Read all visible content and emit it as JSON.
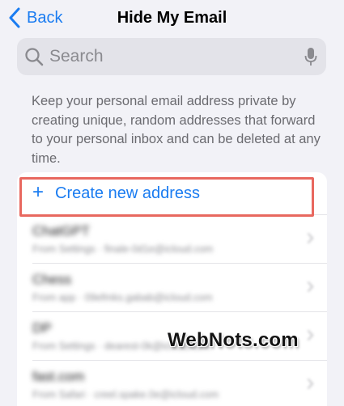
{
  "nav": {
    "back_label": "Back",
    "title": "Hide My Email"
  },
  "search": {
    "placeholder": "Search"
  },
  "description": "Keep your personal email address private by creating unique, random addresses that forward to your personal inbox and can be deleted at any time.",
  "list": {
    "create_plus": "+",
    "create_label": "Create new address",
    "addresses": [
      {
        "name": "ChatGPT",
        "subtitle": "From Settings · finale-0d1e@icloud.com"
      },
      {
        "name": "Chess",
        "subtitle": "From app · 09efmks.gabab@icloud.com"
      },
      {
        "name": "DP",
        "subtitle": "From Settings · dearest-0k@icloud.com"
      },
      {
        "name": "fast.com",
        "subtitle": "From Safari · creel.spake.0e@icloud.com"
      }
    ]
  },
  "watermark": "WebNots.com",
  "colors": {
    "accent": "#1a7cf1",
    "highlight_border": "#e8685f",
    "background": "#f2f2f7"
  },
  "icons": [
    "chevron-left-icon",
    "search-icon",
    "microphone-icon",
    "chevron-right-icon"
  ]
}
